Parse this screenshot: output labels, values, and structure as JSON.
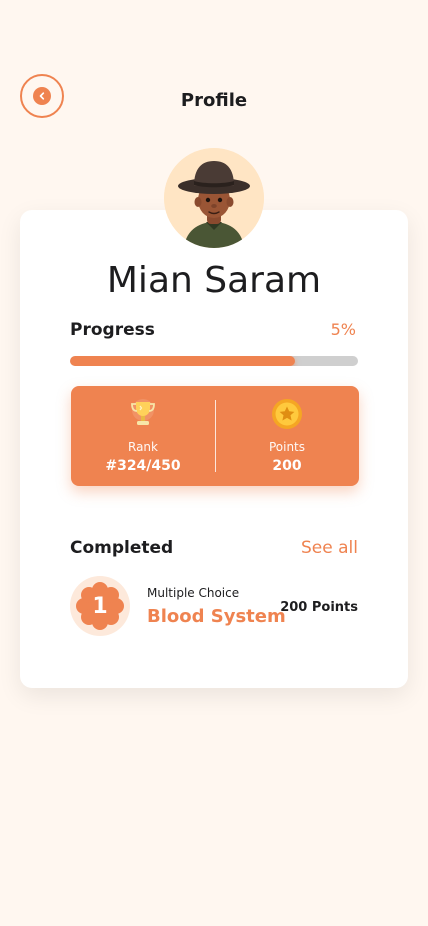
{
  "header": {
    "title": "Profile",
    "back_icon": "chevron-left-icon"
  },
  "profile": {
    "name": "Mian Saram",
    "avatar": "cowboy-avatar"
  },
  "progress": {
    "label": "Progress",
    "value_text": "5%",
    "fill_fraction": 0.78
  },
  "stats": [
    {
      "icon": "trophy-icon",
      "label": "Rank",
      "value": "#324/450"
    },
    {
      "icon": "coin-icon",
      "label": "Points",
      "value": "200"
    }
  ],
  "completed": {
    "title": "Completed",
    "see_all": "See all",
    "items": [
      {
        "number": "1",
        "category": "Multiple Choice",
        "title": "Blood System",
        "points": "200 Points"
      }
    ]
  },
  "colors": {
    "accent": "#ef8350",
    "background": "#fff7f0",
    "card": "#ffffff",
    "track": "#cfcfcf"
  }
}
